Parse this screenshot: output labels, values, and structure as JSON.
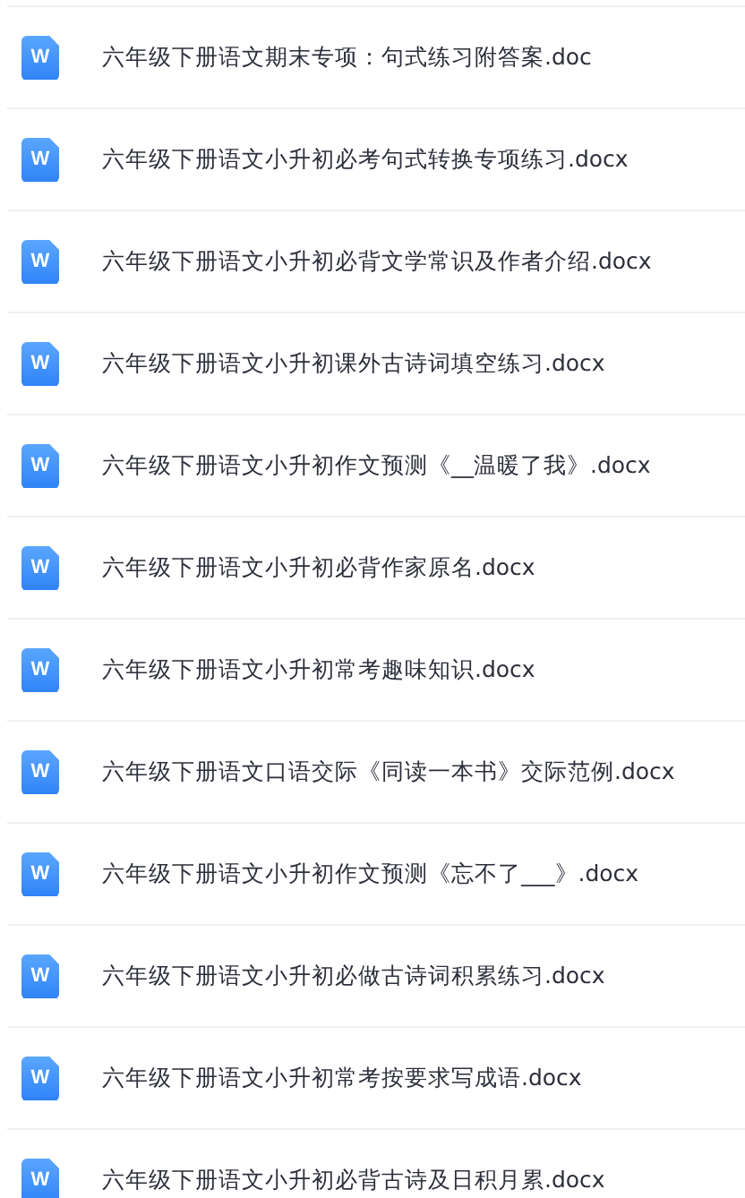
{
  "files": [
    {
      "icon_text": "W",
      "name": "六年级下册语文期末专项：句式练习附答案.doc"
    },
    {
      "icon_text": "W",
      "name": "六年级下册语文小升初必考句式转换专项练习.docx"
    },
    {
      "icon_text": "W",
      "name": "六年级下册语文小升初必背文学常识及作者介绍.docx"
    },
    {
      "icon_text": "W",
      "name": "六年级下册语文小升初课外古诗词填空练习.docx"
    },
    {
      "icon_text": "W",
      "name": "六年级下册语文小升初作文预测《__温暖了我》.docx"
    },
    {
      "icon_text": "W",
      "name": "六年级下册语文小升初必背作家原名.docx"
    },
    {
      "icon_text": "W",
      "name": "六年级下册语文小升初常考趣味知识.docx"
    },
    {
      "icon_text": "W",
      "name": "六年级下册语文口语交际《同读一本书》交际范例.docx"
    },
    {
      "icon_text": "W",
      "name": "六年级下册语文小升初作文预测《忘不了___》.docx"
    },
    {
      "icon_text": "W",
      "name": "六年级下册语文小升初必做古诗词积累练习.docx"
    },
    {
      "icon_text": "W",
      "name": "六年级下册语文小升初常考按要求写成语.docx"
    },
    {
      "icon_text": "W",
      "name": "六年级下册语文小升初必背古诗及日积月累.docx"
    }
  ]
}
